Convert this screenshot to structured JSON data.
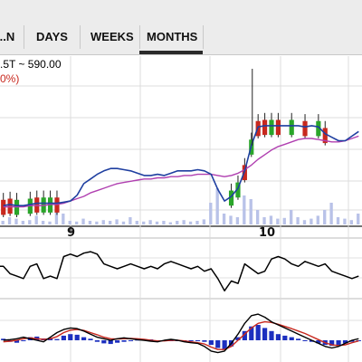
{
  "tabs": [
    {
      "label": "...N"
    },
    {
      "label": "DAYS"
    },
    {
      "label": "WEEKS"
    },
    {
      "label": "MONTHS"
    }
  ],
  "selected_tab": "MONTHS",
  "info": {
    "line1": ".5T ~ 590.00",
    "line2": "0%)"
  },
  "date_labels": [
    "9",
    "10"
  ],
  "colors": {
    "tab_bar_bg": "#ececec",
    "candle_up": "#2aa52a",
    "candle_down": "#c8281e",
    "price_line": "#1f3fa0",
    "ma_line": "#b03fb0",
    "volume_bar": "#b9c2e8",
    "macd_hist": "#1c2fbf",
    "macd_line": "#000000",
    "signal_line": "#c8281e",
    "info_text": "#000000",
    "info_change": "#c8281e"
  },
  "chart_data": [
    {
      "type": "line",
      "panel": "price",
      "x_labels": [
        "9",
        "10"
      ],
      "series": [
        {
          "style": "line",
          "values": [
            0.1,
            0.11,
            0.1,
            0.1,
            0.11,
            0.12,
            0.12,
            0.12,
            0.12,
            0.13,
            0.14,
            0.19,
            0.29,
            0.33,
            0.37,
            0.4,
            0.42,
            0.42,
            0.41,
            0.4,
            0.38,
            0.36,
            0.36,
            0.37,
            0.36,
            0.38,
            0.4,
            0.4,
            0.4,
            0.41,
            0.4,
            0.37,
            0.24,
            0.14,
            0.18,
            0.25,
            0.4,
            0.62,
            0.78,
            0.79,
            0.79,
            0.79,
            0.79,
            0.79,
            0.79,
            0.78,
            0.79,
            0.78,
            0.72,
            0.69,
            0.66,
            0.66,
            0.7,
            0.74
          ]
        },
        {
          "style": "ma",
          "values": [
            0.09,
            0.09,
            0.09,
            0.09,
            0.1,
            0.1,
            0.1,
            0.11,
            0.11,
            0.12,
            0.14,
            0.16,
            0.18,
            0.21,
            0.23,
            0.25,
            0.27,
            0.29,
            0.3,
            0.31,
            0.32,
            0.33,
            0.33,
            0.34,
            0.34,
            0.35,
            0.35,
            0.36,
            0.36,
            0.37,
            0.37,
            0.37,
            0.36,
            0.35,
            0.36,
            0.38,
            0.41,
            0.45,
            0.5,
            0.54,
            0.58,
            0.61,
            0.63,
            0.65,
            0.67,
            0.68,
            0.68,
            0.67,
            0.66,
            0.65,
            0.65,
            0.66,
            0.68,
            0.7
          ]
        }
      ],
      "candles": [
        {
          "i": 0,
          "dir": "down"
        },
        {
          "i": 1,
          "dir": "down"
        },
        {
          "i": 2,
          "dir": "up"
        },
        {
          "i": 4,
          "dir": "up"
        },
        {
          "i": 5,
          "dir": "down"
        },
        {
          "i": 6,
          "dir": "up"
        },
        {
          "i": 7,
          "dir": "up"
        },
        {
          "i": 8,
          "dir": "down"
        },
        {
          "i": 34,
          "dir": "up"
        },
        {
          "i": 35,
          "dir": "up"
        },
        {
          "i": 36,
          "dir": "down"
        },
        {
          "i": 37,
          "dir": "up"
        },
        {
          "i": 38,
          "dir": "down"
        },
        {
          "i": 39,
          "dir": "down"
        },
        {
          "i": 40,
          "dir": "up"
        },
        {
          "i": 41,
          "dir": "down"
        },
        {
          "i": 43,
          "dir": "up"
        },
        {
          "i": 45,
          "dir": "down"
        },
        {
          "i": 47,
          "dir": "up"
        },
        {
          "i": 48,
          "dir": "down"
        }
      ],
      "volume": [
        0.05,
        0.1,
        0.08,
        0.05,
        0.06,
        0.12,
        0.05,
        0.04,
        0.2,
        0.15,
        0.05,
        0.04,
        0.08,
        0.05,
        0.04,
        0.06,
        0.05,
        0.07,
        0.04,
        0.1,
        0.05,
        0.04,
        0.06,
        0.04,
        0.05,
        0.03,
        0.05,
        0.06,
        0.04,
        0.05,
        0.07,
        0.3,
        0.5,
        0.15,
        0.12,
        0.1,
        0.4,
        0.35,
        0.2,
        0.1,
        0.12,
        0.08,
        0.09,
        0.2,
        0.1,
        0.06,
        0.08,
        0.12,
        0.2,
        0.3,
        0.1,
        0.08,
        0.06,
        0.15
      ]
    },
    {
      "type": "line",
      "panel": "oscillator",
      "series": [
        {
          "style": "line",
          "values": [
            0.55,
            0.4,
            0.35,
            0.3,
            0.55,
            0.6,
            0.3,
            0.35,
            0.3,
            0.75,
            0.8,
            0.75,
            0.82,
            0.85,
            0.8,
            0.6,
            0.55,
            0.5,
            0.55,
            0.6,
            0.55,
            0.5,
            0.55,
            0.5,
            0.6,
            0.65,
            0.6,
            0.55,
            0.5,
            0.55,
            0.45,
            0.5,
            0.3,
            0.05,
            0.25,
            0.2,
            0.6,
            0.5,
            0.4,
            0.45,
            0.7,
            0.75,
            0.7,
            0.6,
            0.55,
            0.65,
            0.6,
            0.55,
            0.6,
            0.45,
            0.4,
            0.35,
            0.3,
            0.35
          ]
        }
      ]
    },
    {
      "type": "bar",
      "panel": "macd",
      "histogram": [
        0.05,
        -0.05,
        -0.08,
        -0.03,
        0.1,
        0.12,
        0.06,
        0.08,
        0.04,
        0.15,
        0.2,
        0.18,
        0.1,
        0.05,
        -0.05,
        -0.1,
        -0.12,
        -0.08,
        -0.05,
        -0.03,
        0.02,
        0.04,
        0.03,
        -0.02,
        0.0,
        -0.03,
        -0.02,
        0.0,
        -0.01,
        -0.03,
        -0.05,
        -0.15,
        -0.25,
        -0.3,
        -0.2,
        0.1,
        0.3,
        0.45,
        0.5,
        0.4,
        0.3,
        0.2,
        0.15,
        0.1,
        0.05,
        0.0,
        -0.05,
        -0.1,
        -0.15,
        -0.18,
        -0.15,
        -0.1,
        -0.05,
        0.0
      ],
      "series": [
        {
          "style": "macd",
          "values": [
            0.0,
            0.02,
            0.05,
            0.1,
            0.05,
            0.0,
            -0.05,
            0.1,
            0.25,
            0.35,
            0.4,
            0.38,
            0.3,
            0.2,
            0.1,
            0.05,
            0.0,
            0.05,
            0.08,
            0.05,
            0.02,
            0.0,
            -0.03,
            -0.05,
            0.0,
            0.03,
            0.0,
            -0.05,
            -0.08,
            -0.1,
            -0.2,
            -0.35,
            -0.4,
            -0.35,
            -0.1,
            0.2,
            0.55,
            0.8,
            0.85,
            0.75,
            0.6,
            0.5,
            0.4,
            0.3,
            0.2,
            0.1,
            0.0,
            -0.1,
            -0.2,
            -0.25,
            -0.2,
            -0.1,
            0.0,
            0.05
          ]
        },
        {
          "style": "signal",
          "values": [
            -0.05,
            -0.03,
            0.0,
            0.05,
            0.08,
            0.05,
            0.03,
            0.05,
            0.12,
            0.25,
            0.33,
            0.35,
            0.32,
            0.25,
            0.18,
            0.1,
            0.05,
            0.04,
            0.05,
            0.06,
            0.05,
            0.03,
            0.0,
            -0.02,
            -0.02,
            0.0,
            0.0,
            -0.02,
            -0.05,
            -0.08,
            -0.12,
            -0.22,
            -0.3,
            -0.3,
            -0.2,
            0.0,
            0.2,
            0.4,
            0.55,
            0.6,
            0.58,
            0.52,
            0.45,
            0.38,
            0.3,
            0.22,
            0.12,
            0.02,
            -0.08,
            -0.15,
            -0.17,
            -0.15,
            -0.08,
            -0.02
          ]
        }
      ]
    }
  ]
}
